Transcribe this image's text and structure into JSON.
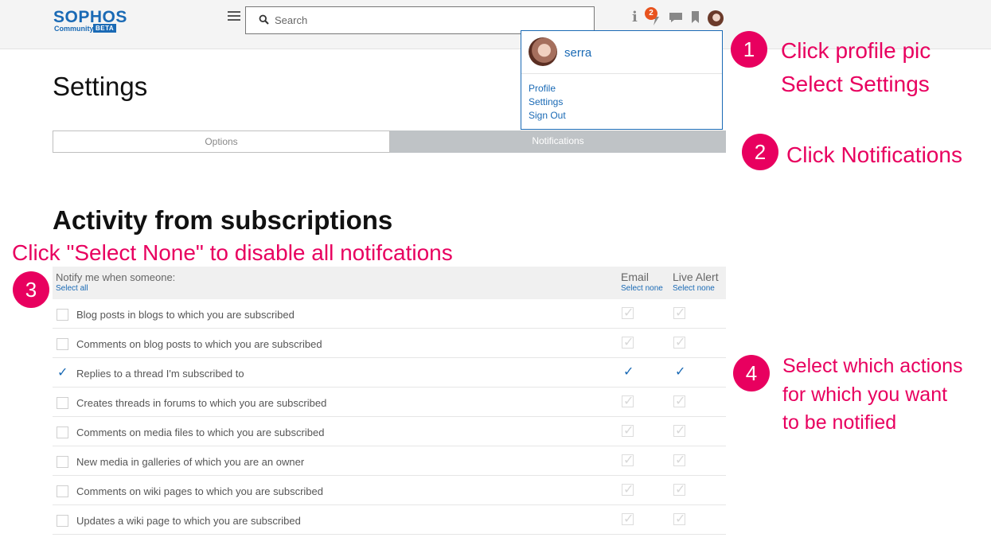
{
  "header": {
    "logo": "SOPHOS",
    "logo_sub": "Community",
    "logo_beta": "BETA",
    "search_placeholder": "Search",
    "notification_count": "2"
  },
  "profile_menu": {
    "username": "serra",
    "items": [
      "Profile",
      "Settings",
      "Sign Out"
    ]
  },
  "page": {
    "title": "Settings",
    "tabs": [
      "Options",
      "Notifications"
    ],
    "active_tab": "Notifications",
    "section_title": "Activity from subscriptions"
  },
  "table": {
    "header_label": "Notify me when someone:",
    "select_all": "Select all",
    "col_email": "Email",
    "col_live": "Live Alert",
    "select_none": "Select none",
    "rows": [
      {
        "label": "Blog posts in blogs to which you are subscribed",
        "checked": false
      },
      {
        "label": "Comments on blog posts to which you are subscribed",
        "checked": false
      },
      {
        "label": "Replies to a thread I'm subscribed to",
        "checked": true
      },
      {
        "label": "Creates threads in forums to which you are subscribed",
        "checked": false
      },
      {
        "label": "Comments on media files to which you are subscribed",
        "checked": false
      },
      {
        "label": "New media in galleries of which you are an owner",
        "checked": false
      },
      {
        "label": "Comments on wiki pages to which you are subscribed",
        "checked": false
      },
      {
        "label": "Updates a wiki page to which you are subscribed",
        "checked": false
      }
    ]
  },
  "annotations": {
    "step1": "1",
    "step1_line1": "Click profile pic",
    "step1_line2": "Select Settings",
    "step2": "2",
    "step2_text": "Click Notifications",
    "step3": "3",
    "step3_text": "Click \"Select None\" to disable all notifcations",
    "step4": "4",
    "step4_line1": "Select which actions",
    "step4_line2": "for which you want",
    "step4_line3": "to be notified"
  },
  "colors": {
    "brand": "#1a6ab5",
    "annotation": "#e8005f",
    "badge": "#e8531e"
  }
}
